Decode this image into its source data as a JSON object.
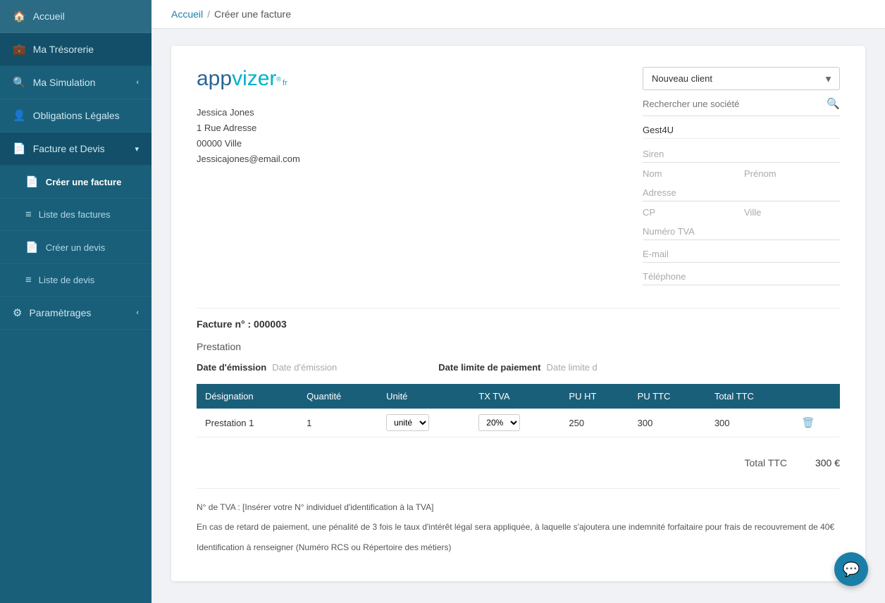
{
  "sidebar": {
    "items": [
      {
        "id": "accueil",
        "label": "Accueil",
        "icon": "🏠",
        "active": false
      },
      {
        "id": "tresorerie",
        "label": "Ma Trésorerie",
        "icon": "💼",
        "active": false
      },
      {
        "id": "simulation",
        "label": "Ma Simulation",
        "icon": "🔍",
        "active": false,
        "arrow": "‹"
      },
      {
        "id": "obligations",
        "label": "Obligations Légales",
        "icon": "👤",
        "active": false
      },
      {
        "id": "facture",
        "label": "Facture et Devis",
        "icon": "📄",
        "active": true,
        "arrow": "▾"
      },
      {
        "id": "creer-facture",
        "label": "Créer une facture",
        "icon": "📄",
        "sub": true,
        "active": true
      },
      {
        "id": "liste-factures",
        "label": "Liste des factures",
        "icon": "≡",
        "sub": true
      },
      {
        "id": "creer-devis",
        "label": "Créer un devis",
        "icon": "📄",
        "sub": true
      },
      {
        "id": "liste-devis",
        "label": "Liste de devis",
        "icon": "≡",
        "sub": true
      },
      {
        "id": "parametrages",
        "label": "Paramètrages",
        "icon": "⚙",
        "active": false,
        "arrow": "‹"
      }
    ]
  },
  "breadcrumb": {
    "home": "Accueil",
    "separator": "/",
    "current": "Créer une facture"
  },
  "invoice": {
    "logo": {
      "text_start": "appvizer",
      "registered": "®",
      "suffix": "fr"
    },
    "sender": {
      "name": "Jessica Jones",
      "address": "1 Rue Adresse",
      "city": "00000 Ville",
      "email": "Jessicajones@email.com"
    },
    "client_selector": {
      "label": "Nouveau client",
      "search_placeholder": "Rechercher une société",
      "company": "Gest4U",
      "fields": {
        "siren": "Siren",
        "nom": "Nom",
        "prenom": "Prénom",
        "adresse": "Adresse",
        "cp": "CP",
        "ville": "Ville",
        "tva": "Numéro TVA",
        "email": "E-mail",
        "telephone": "Téléphone"
      }
    },
    "number_label": "Facture n° : 000003",
    "prestation_label": "Prestation",
    "date_emission_label": "Date d'émission",
    "date_emission_value": "Date d'émission",
    "date_limite_label": "Date limite de paiement",
    "date_limite_value": "Date limite d",
    "table": {
      "headers": [
        "Désignation",
        "Quantité",
        "Unité",
        "TX TVA",
        "PU HT",
        "PU TTC",
        "Total TTC"
      ],
      "rows": [
        {
          "designation": "Prestation 1",
          "quantite": "1",
          "unite": "unité",
          "tx_tva": "20%",
          "pu_ht": "250",
          "pu_ttc": "300",
          "total_ttc": "300"
        }
      ]
    },
    "total_label": "Total TTC",
    "total_value": "300 €",
    "notes": [
      "N° de TVA : [Insérer votre N° individuel d'identification à la TVA]",
      "En cas de retard de paiement, une pénalité de 3 fois le taux d'intérêt légal sera appliquée, à laquelle s'ajoutera une indemnité forfaitaire pour frais de recouvrement de 40€",
      "Identification à renseigner (Numéro RCS ou Répertoire des métiers)"
    ]
  },
  "chat": {
    "icon": "💬"
  }
}
